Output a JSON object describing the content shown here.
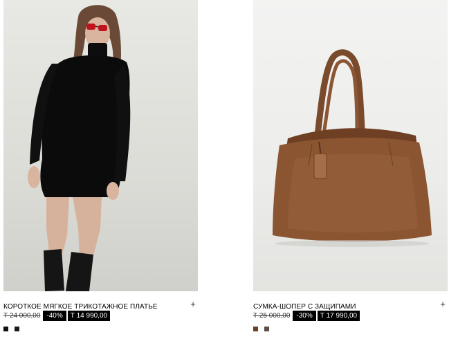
{
  "products": [
    {
      "name": "КОРОТКОЕ МЯГКОЕ ТРИКОТАЖНОЕ ПЛАТЬЕ",
      "old_price": "Т 24 000,00",
      "discount": "-40%",
      "new_price": "Т 14 990,00",
      "add_icon": "+",
      "image_icon": "dress-photo",
      "swatches": [
        {
          "color": "#111111"
        },
        {
          "color": "#1a1a1a"
        }
      ]
    },
    {
      "name": "СУМКА-ШОПЕР С ЗАЩИПАМИ",
      "old_price": "Т 25 000,00",
      "discount": "-30%",
      "new_price": "Т 17 990,00",
      "add_icon": "+",
      "image_icon": "bag-photo",
      "swatches": [
        {
          "color": "#6b4028"
        },
        {
          "color": "#5a4f49"
        }
      ]
    }
  ]
}
